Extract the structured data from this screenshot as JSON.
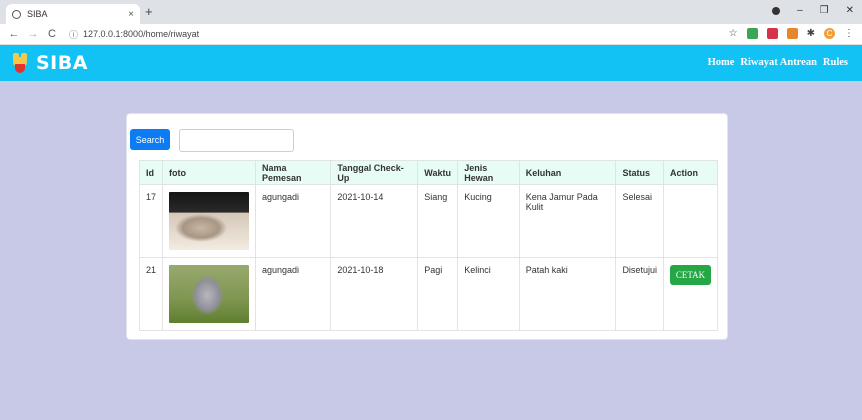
{
  "browser": {
    "tab_title": "SIBA",
    "tab_close": "×",
    "new_tab": "+",
    "url": "127.0.0.1:8000/home/riwayat",
    "controls": {
      "minimize": "–",
      "restore": "❐",
      "close": "✕"
    },
    "nav": {
      "back": "←",
      "forward": "→",
      "reload": "C"
    },
    "icons": [
      "globe-icon",
      "info-icon",
      "star-icon",
      "extension-icon",
      "puzzle-icon",
      "profile-icon",
      "menu-dots-icon"
    ],
    "menu": "⋮",
    "star": "☆",
    "puzzle": "✱",
    "profile_initial": "C"
  },
  "navbar": {
    "brand": "SIBA",
    "links": [
      "Home",
      "Riwayat Antrean",
      "Rules"
    ],
    "color": "#12c2f5"
  },
  "search": {
    "button_label": "Search",
    "value": ""
  },
  "table": {
    "headers": [
      "Id",
      "foto",
      "Nama Pemesan",
      "Tanggal Check-Up",
      "Waktu",
      "Jenis Hewan",
      "Keluhan",
      "Status",
      "Action"
    ],
    "rows": [
      {
        "id": "17",
        "foto": "cat photo",
        "nama": "agungadi",
        "tanggal": "2021-10-14",
        "waktu": "Siang",
        "jenis": "Kucing",
        "keluhan": "Kena Jamur Pada Kulit",
        "status": "Selesai",
        "action": ""
      },
      {
        "id": "21",
        "foto": "rabbit photo",
        "nama": "agungadi",
        "tanggal": "2021-10-18",
        "waktu": "Pagi",
        "jenis": "Kelinci",
        "keluhan": "Patah kaki",
        "status": "Disetujui",
        "action": "CETAK"
      }
    ]
  },
  "colors": {
    "page_bg": "#c8c9e6",
    "search_button": "#0d7bf3",
    "cetak_button": "#25a745",
    "table_header": "#e6fcf4"
  }
}
